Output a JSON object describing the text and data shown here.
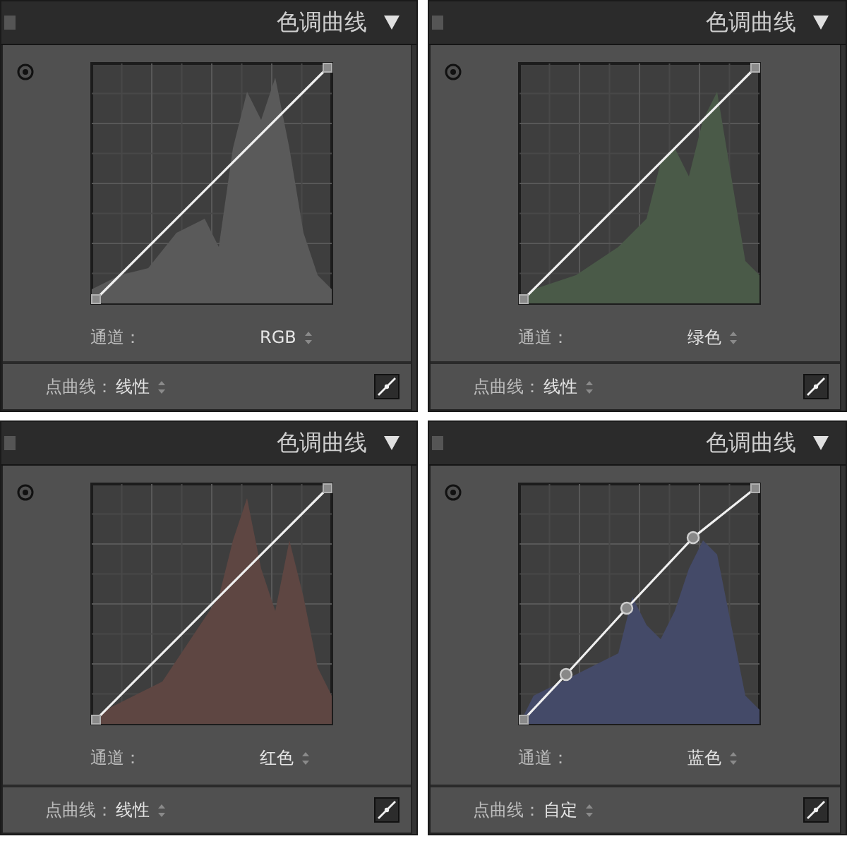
{
  "panels": [
    {
      "title": "色调曲线",
      "channel_label": "通道：",
      "channel": "RGB",
      "point_curve_label": "点曲线：",
      "point_curve": "线性",
      "kind": "linear",
      "color": "#5a5a5a"
    },
    {
      "title": "色调曲线",
      "channel_label": "通道：",
      "channel": "绿色",
      "point_curve_label": "点曲线：",
      "point_curve": "线性",
      "kind": "linear",
      "color": "#4a5a48"
    },
    {
      "title": "色调曲线",
      "channel_label": "通道：",
      "channel": "红色",
      "point_curve_label": "点曲线：",
      "point_curve": "线性",
      "kind": "linear",
      "color": "#5e4642"
    },
    {
      "title": "色调曲线",
      "channel_label": "通道：",
      "channel": "蓝色",
      "point_curve_label": "点曲线：",
      "point_curve": "自定",
      "kind": "custom",
      "color": "#444a68"
    }
  ]
}
